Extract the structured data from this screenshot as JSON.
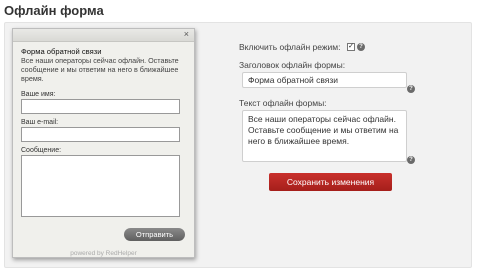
{
  "page": {
    "title": "Офлайн форма"
  },
  "widget_preview": {
    "close_icon": "×",
    "title": "Форма обратной связи",
    "description": "Все наши операторы сейчас офлайн. Оставьте сообщение и мы ответим на него в ближайшее время.",
    "name_label": "Ваше имя:",
    "email_label": "Ваш e-mail:",
    "message_label": "Сообщение:",
    "send_button": "Отправить",
    "powered_by": "powered by RedHelper"
  },
  "settings": {
    "enable_label": "Включить офлайн режим:",
    "enable_checked": true,
    "header_label": "Заголовок офлайн формы:",
    "header_value": "Форма обратной связи",
    "text_label": "Текст офлайн формы:",
    "text_value": "Все наши операторы сейчас офлайн. Оставьте сообщение и мы ответим на него в ближайшее время.",
    "save_button": "Сохранить изменения",
    "help_icon": "?",
    "check_mark": "✓"
  },
  "colors": {
    "accent": "#b8241f",
    "panel_bg": "#f2f2f2"
  }
}
